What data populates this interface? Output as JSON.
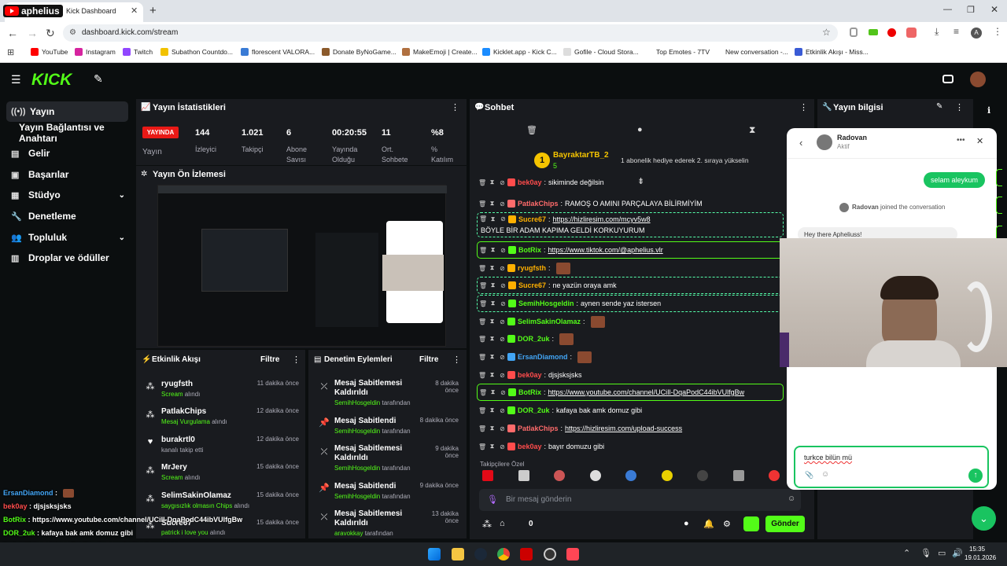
{
  "browser": {
    "tab_title": "Kick Dashboard",
    "overlay_channel": "aphelius",
    "url": "dashboard.kick.com/stream",
    "bookmarks": [
      "YouTube",
      "Instagram",
      "Twitch",
      "Subathon Countdo...",
      "florescent VALORA...",
      "Donate ByNoGame...",
      "MakeEmoji | Create...",
      "Kicklet.app - Kick C...",
      "Gofile - Cloud Stora...",
      "Top Emotes - 7TV",
      "New conversation -...",
      "Etkinlik Akışı - Miss..."
    ]
  },
  "sidebar": {
    "items": [
      {
        "label": "Yayın",
        "icon": "broadcast-icon"
      },
      {
        "label": "Yayın Bağlantısı ve Anahtarı",
        "icon": ""
      },
      {
        "label": "Gelir",
        "icon": "revenue-icon"
      },
      {
        "label": "Başarılar",
        "icon": "achievements-icon"
      },
      {
        "label": "Stüdyo",
        "icon": "studio-icon"
      },
      {
        "label": "Denetleme",
        "icon": "moderation-icon"
      },
      {
        "label": "Topluluk",
        "icon": "community-icon"
      },
      {
        "label": "Droplar ve ödüller",
        "icon": "drops-icon"
      }
    ]
  },
  "stats": {
    "title": "Yayın İstatistikleri",
    "live_badge": "YAYINDA",
    "live_label": "Yayın",
    "items": [
      {
        "value": "144",
        "label": "İzleyici"
      },
      {
        "value": "1.021",
        "label": "Takipçi"
      },
      {
        "value": "6",
        "label": "Abone Savısı"
      },
      {
        "value": "00:20:55",
        "label": "Yayında Olduğu"
      },
      {
        "value": "11",
        "label": "Ort. Sohbete"
      },
      {
        "value": "%8",
        "label": "% Katılım"
      }
    ]
  },
  "preview": {
    "title": "Yayın Ön İzlemesi"
  },
  "activity": {
    "title": "Etkinlik Akışı",
    "filter": "Filtre",
    "events": [
      {
        "name": "ryugfsth",
        "sub": "Scream",
        "suffix": "alındı",
        "time": "11 dakika önce"
      },
      {
        "name": "PatlakChips",
        "sub": "Mesaj Vurgulama",
        "suffix": "alındı",
        "time": "12 dakika önce"
      },
      {
        "name": "burakrtl0",
        "sub": "",
        "suffix": "kanalı takip etti",
        "time": "12 dakika önce"
      },
      {
        "name": "MrJery",
        "sub": "Scream",
        "suffix": "alındı",
        "time": "15 dakika önce"
      },
      {
        "name": "SelimSakinOlamaz",
        "sub": "saygısızlık olmasın Chips",
        "suffix": "alındı",
        "time": "15 dakika önce"
      },
      {
        "name": "Sucre67",
        "sub": "patrick i love you",
        "suffix": "alındı",
        "time": "15 dakika önce"
      }
    ]
  },
  "modlog": {
    "title": "Denetim Eylemleri",
    "filter": "Filtre",
    "items": [
      {
        "action": "Mesaj Sabitlemesi Kaldırıldı",
        "by": "SemihHosgeldin",
        "suffix": "tarafından",
        "time": "8 dakika önce"
      },
      {
        "action": "Mesaj Sabitlendi",
        "by": "SemihHosgeldin",
        "suffix": "tarafından",
        "time": "8 dakika önce"
      },
      {
        "action": "Mesaj Sabitlemesi Kaldırıldı",
        "by": "SemihHosgeldin",
        "suffix": "tarafından",
        "time": "9 dakika önce"
      },
      {
        "action": "Mesaj Sabitlendi",
        "by": "SemihHosgeldin",
        "suffix": "tarafından",
        "time": "9 dakika önce"
      },
      {
        "action": "Mesaj Sabitlemesi Kaldırıldı",
        "by": "aravokkay",
        "suffix": "tarafından",
        "time": "13 dakika önce"
      }
    ]
  },
  "chat": {
    "title": "Sohbet",
    "pinned_user": "BayraktarTB_2",
    "pinned_count": "5",
    "pinned_msg": "1 abonelik hediye ederek 2. sıraya yükselin",
    "lines": [
      {
        "user": "bek0ay",
        "color": "#ff4c4c",
        "text": "sikiminde değilsin",
        "style": ""
      },
      {
        "user": "PatlakChips",
        "color": "#ff6b6b",
        "text": "RAMOŞ O AMINI PARÇALAYA BİLİRMİYİM",
        "style": ""
      },
      {
        "user": "Sucre67",
        "color": "#ffb000",
        "text": "https://hizliresim.com/mcyv5w8",
        "text2": "BÖYLE BİR ADAM KAPIMA GELDİ KORKUYURUM",
        "style": "hl"
      },
      {
        "user": "BotRix",
        "color": "#53fc18",
        "text": "https://www.tiktok.com/@aphelius.vlr",
        "style": "mod"
      },
      {
        "user": "ryugfsth",
        "color": "#ffb000",
        "text": "",
        "style": ""
      },
      {
        "user": "Sucre67",
        "color": "#ffb000",
        "text": "ne yazün oraya amk",
        "style": "hl"
      },
      {
        "user": "SemihHosgeldin",
        "color": "#53fc18",
        "text": "aynen sende yaz istersen",
        "style": "hl"
      },
      {
        "user": "SelimSakinOlamaz",
        "color": "#53fc18",
        "text": "",
        "style": ""
      },
      {
        "user": "DOR_2uk",
        "color": "#53fc18",
        "text": "",
        "style": ""
      },
      {
        "user": "ErsanDiamond",
        "color": "#42a5f5",
        "text": "",
        "style": ""
      },
      {
        "user": "bek0ay",
        "color": "#ff4c4c",
        "text": "djsjsksjsks",
        "style": ""
      },
      {
        "user": "BotRix",
        "color": "#53fc18",
        "text": "https://www.youtube.com/channel/UCiIl-DqaPodC44ibVUlfgBw",
        "style": "mod"
      },
      {
        "user": "DOR_2uk",
        "color": "#53fc18",
        "text": "kafaya bak amk domuz gibi",
        "style": ""
      },
      {
        "user": "PatlakChips",
        "color": "#ff6b6b",
        "text": "https://hizliresim.com/upload-success",
        "style": ""
      },
      {
        "user": "bek0ay",
        "color": "#ff4c4c",
        "text": "bayır domuzu gibi",
        "style": ""
      }
    ],
    "followers_only": "Takipçilere Özel",
    "input_placeholder": "Bir mesaj gönderin",
    "points": "0",
    "send": "Gönder"
  },
  "streaminfo": {
    "title": "Yayın bilgisi"
  },
  "messenger": {
    "name": "Radovan",
    "status": "Aktif",
    "bubble": "selam aleykum",
    "joined": "joined the conversation",
    "greeting": "Hey there Apheliuss!",
    "draft": "turkce bilün mü"
  },
  "overlay_chat": [
    {
      "user": "ErsanDiamond",
      "text": "",
      "color": "#42a5f5"
    },
    {
      "user": "bek0ay",
      "text": "djsjsksjsks",
      "color": "#ff4c4c"
    },
    {
      "user": "BotRix",
      "text": "https://www.youtube.com/channel/UCiIl-DqaPodC44ibVUlfgBw",
      "color": "#53fc18"
    },
    {
      "user": "DOR_2uk",
      "text": "kafaya bak amk domuz gibi",
      "color": "#53fc18"
    },
    {
      "user": "PatlakChips",
      "text": "https://hizliresim.com/upload-success",
      "color": "#ffffff"
    },
    {
      "user": "bek0ay",
      "text": "bayır domuzu gibi",
      "color": "#ff4c4c"
    }
  ],
  "taskbar": {
    "time": "15:35",
    "date": "19.01.2026"
  }
}
